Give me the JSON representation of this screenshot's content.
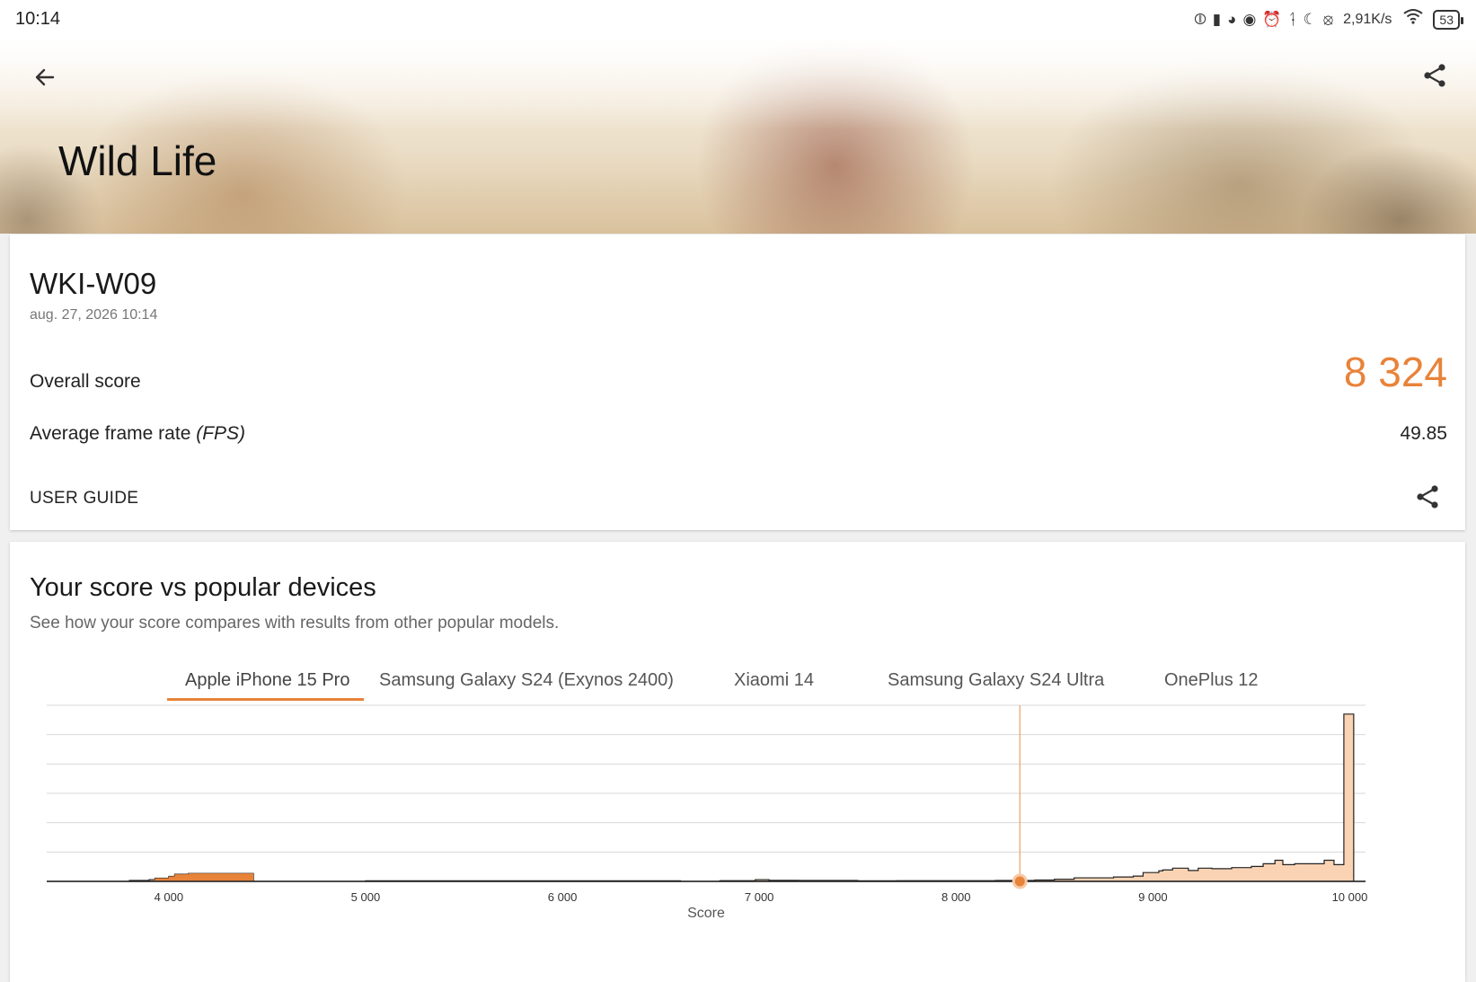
{
  "status_bar": {
    "time": "10:14",
    "network_speed": "2,91K/s",
    "battery": "53",
    "icons": [
      "nfc-icon",
      "book-icon",
      "speedometer-icon",
      "eye-icon",
      "alarm-icon",
      "bluetooth-icon",
      "moon-icon",
      "mute-icon",
      "wifi-icon",
      "battery-icon"
    ]
  },
  "header": {
    "title": "Wild Life",
    "back_icon": "arrow-left-icon",
    "share_icon": "share-icon"
  },
  "result": {
    "device": "WKI-W09",
    "date": "aug. 27, 2026 10:14",
    "overall_label": "Overall score",
    "overall_value": "8 324",
    "fps_label_main": "Average frame rate ",
    "fps_label_unit": "(FPS)",
    "fps_value": "49.85",
    "user_guide_label": "USER GUIDE"
  },
  "comparison": {
    "title": "Your score vs popular devices",
    "subtitle": "See how your score compares with results from other popular models.",
    "tabs": [
      {
        "label": "Apple iPhone 15 Pro",
        "active": true
      },
      {
        "label": "Samsung Galaxy S24 (Exynos 2400)",
        "active": false
      },
      {
        "label": "Xiaomi 14",
        "active": false
      },
      {
        "label": "Samsung Galaxy S24 Ultra",
        "active": false
      },
      {
        "label": "OnePlus 12",
        "active": false
      }
    ]
  },
  "chart_data": {
    "type": "area",
    "xlabel": "Score",
    "ylabel": "",
    "title": "",
    "xlim": [
      3380,
      10080
    ],
    "ylim": [
      0,
      1
    ],
    "grid": true,
    "x_ticks": [
      "4 000",
      "5 000",
      "6 000",
      "7 000",
      "8 000",
      "9 000",
      "10 000"
    ],
    "x_tick_values": [
      4000,
      5000,
      6000,
      7000,
      8000,
      9000,
      10000
    ],
    "your_score": 8324,
    "accent_color": "#e8833a",
    "fill_color": "#f9d3b4",
    "distribution": [
      {
        "x": 3380,
        "y": 0.0
      },
      {
        "x": 3700,
        "y": 0.0
      },
      {
        "x": 3800,
        "y": 0.005
      },
      {
        "x": 3900,
        "y": 0.01
      },
      {
        "x": 3930,
        "y": 0.018
      },
      {
        "x": 4000,
        "y": 0.028
      },
      {
        "x": 4030,
        "y": 0.04
      },
      {
        "x": 4100,
        "y": 0.045
      },
      {
        "x": 4200,
        "y": 0.045
      },
      {
        "x": 4300,
        "y": 0.045
      },
      {
        "x": 4420,
        "y": 0.045
      },
      {
        "x": 4430,
        "y": 0.0
      },
      {
        "x": 5000,
        "y": 0.003
      },
      {
        "x": 6600,
        "y": 0.0
      },
      {
        "x": 6800,
        "y": 0.004
      },
      {
        "x": 6980,
        "y": 0.01
      },
      {
        "x": 7050,
        "y": 0.006
      },
      {
        "x": 7200,
        "y": 0.005
      },
      {
        "x": 7500,
        "y": 0.003
      },
      {
        "x": 7700,
        "y": 0.004
      },
      {
        "x": 8000,
        "y": 0.004
      },
      {
        "x": 8200,
        "y": 0.005
      },
      {
        "x": 8400,
        "y": 0.008
      },
      {
        "x": 8500,
        "y": 0.012
      },
      {
        "x": 8600,
        "y": 0.02
      },
      {
        "x": 8700,
        "y": 0.02
      },
      {
        "x": 8800,
        "y": 0.025
      },
      {
        "x": 8900,
        "y": 0.03
      },
      {
        "x": 8950,
        "y": 0.05
      },
      {
        "x": 9030,
        "y": 0.06
      },
      {
        "x": 9050,
        "y": 0.065
      },
      {
        "x": 9100,
        "y": 0.075
      },
      {
        "x": 9180,
        "y": 0.062
      },
      {
        "x": 9230,
        "y": 0.075
      },
      {
        "x": 9300,
        "y": 0.072
      },
      {
        "x": 9400,
        "y": 0.078
      },
      {
        "x": 9500,
        "y": 0.085
      },
      {
        "x": 9560,
        "y": 0.1
      },
      {
        "x": 9620,
        "y": 0.12
      },
      {
        "x": 9660,
        "y": 0.095
      },
      {
        "x": 9720,
        "y": 0.1
      },
      {
        "x": 9800,
        "y": 0.1
      },
      {
        "x": 9870,
        "y": 0.12
      },
      {
        "x": 9920,
        "y": 0.095
      },
      {
        "x": 9970,
        "y": 0.95
      },
      {
        "x": 10010,
        "y": 0.95
      },
      {
        "x": 10020,
        "y": 0.0
      },
      {
        "x": 10080,
        "y": 0.0
      }
    ]
  }
}
